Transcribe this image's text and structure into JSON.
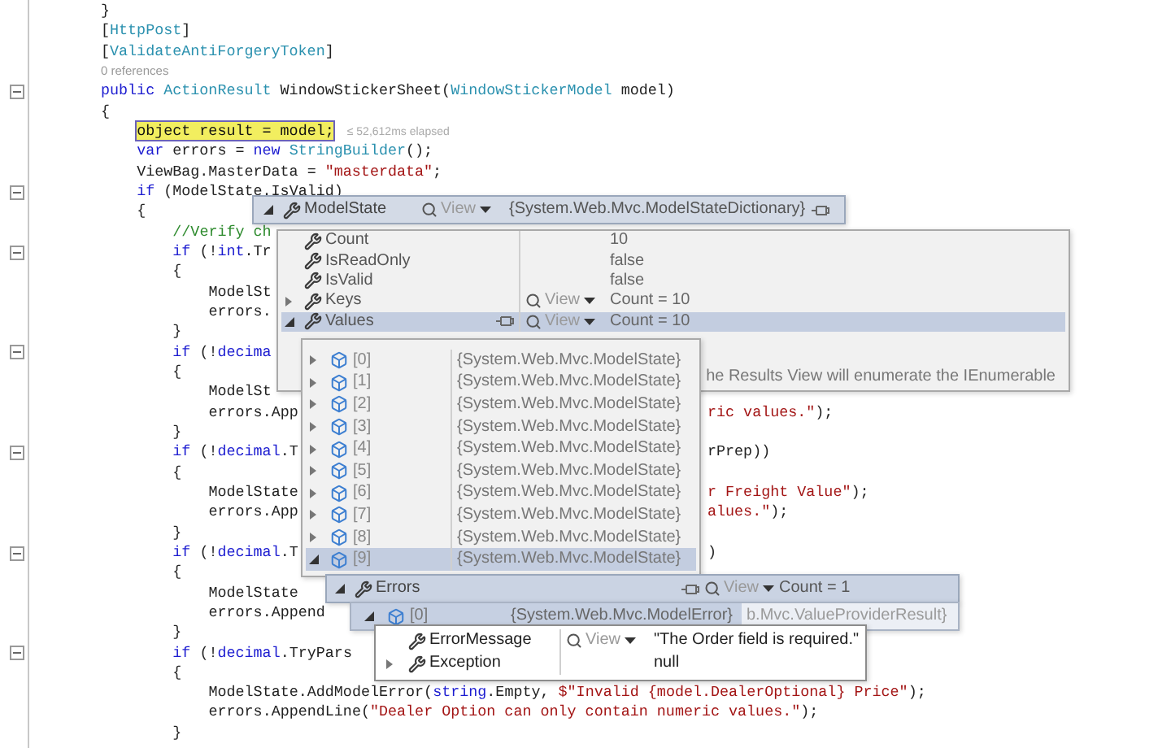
{
  "code": [
    {
      "kind": "code",
      "foldable": false,
      "segments": [
        {
          "kind": "plain",
          "text": "}"
        }
      ]
    },
    {
      "kind": "code",
      "foldable": false,
      "segments": [
        {
          "kind": "plain",
          "text": "["
        },
        {
          "kind": "type",
          "text": "HttpPost"
        },
        {
          "kind": "plain",
          "text": "]"
        }
      ]
    },
    {
      "kind": "code",
      "foldable": false,
      "segments": [
        {
          "kind": "plain",
          "text": "["
        },
        {
          "kind": "type",
          "text": "ValidateAntiForgeryToken"
        },
        {
          "kind": "plain",
          "text": "]"
        }
      ]
    },
    {
      "kind": "codelens",
      "foldable": false,
      "text": "0 references"
    },
    {
      "kind": "code",
      "foldable": true,
      "segments": [
        {
          "kind": "kw",
          "text": "public "
        },
        {
          "kind": "type",
          "text": "ActionResult "
        },
        {
          "kind": "plain",
          "text": "WindowStickerSheet("
        },
        {
          "kind": "type",
          "text": "WindowStickerModel "
        },
        {
          "kind": "plain",
          "text": "model)"
        }
      ]
    },
    {
      "kind": "code",
      "foldable": false,
      "segments": [
        {
          "kind": "plain",
          "text": "{"
        }
      ],
      "children": [
        {
          "kind": "code",
          "foldable": false,
          "segments": [
            {
              "kind": "current",
              "text": "object result = model;"
            }
          ],
          "note": "≤ 52,612ms elapsed"
        },
        {
          "kind": "code",
          "foldable": false,
          "segments": [
            {
              "kind": "kw",
              "text": "var "
            },
            {
              "kind": "plain",
              "text": "errors = "
            },
            {
              "kind": "kw",
              "text": "new "
            },
            {
              "kind": "type",
              "text": "StringBuilder"
            },
            {
              "kind": "plain",
              "text": "();"
            }
          ]
        },
        {
          "kind": "code",
          "foldable": false,
          "segments": [
            {
              "kind": "plain",
              "text": "ViewBag.MasterData = "
            },
            {
              "kind": "str",
              "text": "\"masterdata\""
            },
            {
              "kind": "plain",
              "text": ";"
            }
          ]
        },
        {
          "kind": "code",
          "foldable": true,
          "segments": [
            {
              "kind": "kw",
              "text": "if "
            },
            {
              "kind": "plain",
              "text": "(ModelState.IsValid)"
            }
          ]
        },
        {
          "kind": "code",
          "foldable": false,
          "segments": [
            {
              "kind": "plain",
              "text": "{"
            }
          ],
          "children": [
            {
              "kind": "code",
              "foldable": false,
              "segments": [
                {
                  "kind": "comment",
                  "text": "//Verify ch"
                }
              ]
            },
            {
              "kind": "code",
              "foldable": true,
              "segments": [
                {
                  "kind": "kw",
                  "text": "if "
                },
                {
                  "kind": "plain",
                  "text": "(!"
                },
                {
                  "kind": "kw",
                  "text": "int"
                },
                {
                  "kind": "plain",
                  "text": ".Tr"
                }
              ]
            },
            {
              "kind": "code",
              "foldable": false,
              "segments": [
                {
                  "kind": "plain",
                  "text": "{"
                }
              ],
              "children": [
                {
                  "kind": "code",
                  "foldable": false,
                  "segments": [
                    {
                      "kind": "plain",
                      "text": "ModelSt"
                    }
                  ]
                },
                {
                  "kind": "code",
                  "foldable": false,
                  "segments": [
                    {
                      "kind": "plain",
                      "text": "errors."
                    }
                  ]
                }
              ]
            },
            {
              "kind": "code",
              "foldable": false,
              "segments": [
                {
                  "kind": "plain",
                  "text": "}"
                }
              ]
            },
            {
              "kind": "code",
              "foldable": true,
              "segments": [
                {
                  "kind": "kw",
                  "text": "if "
                },
                {
                  "kind": "plain",
                  "text": "(!"
                },
                {
                  "kind": "kw",
                  "text": "decima"
                }
              ]
            },
            {
              "kind": "code",
              "foldable": false,
              "segments": [
                {
                  "kind": "plain",
                  "text": "{"
                }
              ],
              "children": [
                {
                  "kind": "code",
                  "foldable": false,
                  "segments": [
                    {
                      "kind": "plain",
                      "text": "ModelSt"
                    }
                  ]
                },
                {
                  "kind": "code",
                  "foldable": false,
                  "segments": [
                    {
                      "kind": "plain",
                      "text": "errors.App"
                    }
                  ],
                  "fragment": [
                    {
                      "kind": "str",
                      "text": "ric values.\""
                    },
                    {
                      "kind": "plain",
                      "text": ");"
                    }
                  ]
                }
              ]
            },
            {
              "kind": "code",
              "foldable": false,
              "segments": [
                {
                  "kind": "plain",
                  "text": "}"
                }
              ]
            },
            {
              "kind": "code",
              "foldable": true,
              "segments": [
                {
                  "kind": "kw",
                  "text": "if "
                },
                {
                  "kind": "plain",
                  "text": "(!"
                },
                {
                  "kind": "kw",
                  "text": "decimal"
                },
                {
                  "kind": "plain",
                  "text": ".T"
                }
              ],
              "fragment": [
                {
                  "kind": "plain",
                  "text": "rPrep))"
                }
              ]
            },
            {
              "kind": "code",
              "foldable": false,
              "segments": [
                {
                  "kind": "plain",
                  "text": "{"
                }
              ],
              "children": [
                {
                  "kind": "code",
                  "foldable": false,
                  "segments": [
                    {
                      "kind": "plain",
                      "text": "ModelState"
                    }
                  ],
                  "fragment": [
                    {
                      "kind": "str",
                      "text": "r Freight Value\""
                    },
                    {
                      "kind": "plain",
                      "text": ");"
                    }
                  ]
                },
                {
                  "kind": "code",
                  "foldable": false,
                  "segments": [
                    {
                      "kind": "plain",
                      "text": "errors.App"
                    }
                  ],
                  "fragment": [
                    {
                      "kind": "str",
                      "text": "alues.\""
                    },
                    {
                      "kind": "plain",
                      "text": ");"
                    }
                  ]
                }
              ]
            },
            {
              "kind": "code",
              "foldable": false,
              "segments": [
                {
                  "kind": "plain",
                  "text": "}"
                }
              ]
            },
            {
              "kind": "code",
              "foldable": true,
              "segments": [
                {
                  "kind": "kw",
                  "text": "if "
                },
                {
                  "kind": "plain",
                  "text": "(!"
                },
                {
                  "kind": "kw",
                  "text": "decimal"
                },
                {
                  "kind": "plain",
                  "text": ".T"
                }
              ],
              "fragment": [
                {
                  "kind": "plain",
                  "text": ")"
                }
              ]
            },
            {
              "kind": "code",
              "foldable": false,
              "segments": [
                {
                  "kind": "plain",
                  "text": "{"
                }
              ],
              "children": [
                {
                  "kind": "code",
                  "foldable": false,
                  "segments": [
                    {
                      "kind": "plain",
                      "text": "ModelState"
                    }
                  ]
                },
                {
                  "kind": "code",
                  "foldable": false,
                  "segments": [
                    {
                      "kind": "plain",
                      "text": "errors.Append"
                    }
                  ]
                }
              ]
            },
            {
              "kind": "code",
              "foldable": false,
              "segments": [
                {
                  "kind": "plain",
                  "text": "}"
                }
              ]
            },
            {
              "kind": "code",
              "foldable": true,
              "segments": [
                {
                  "kind": "kw",
                  "text": "if "
                },
                {
                  "kind": "plain",
                  "text": "(!"
                },
                {
                  "kind": "kw",
                  "text": "decimal"
                },
                {
                  "kind": "plain",
                  "text": ".TryPars"
                }
              ]
            },
            {
              "kind": "code",
              "foldable": false,
              "segments": [
                {
                  "kind": "plain",
                  "text": "{"
                }
              ],
              "children": [
                {
                  "kind": "code",
                  "foldable": false,
                  "segments": [
                    {
                      "kind": "plain",
                      "text": "ModelState.AddModelError("
                    },
                    {
                      "kind": "kw",
                      "text": "string"
                    },
                    {
                      "kind": "plain",
                      "text": ".Empty, "
                    },
                    {
                      "kind": "str",
                      "text": "$\"Invalid {model.DealerOptional} Price\""
                    },
                    {
                      "kind": "plain",
                      "text": ");"
                    }
                  ]
                },
                {
                  "kind": "code",
                  "foldable": false,
                  "segments": [
                    {
                      "kind": "plain",
                      "text": "errors.AppendLine("
                    },
                    {
                      "kind": "str",
                      "text": "\"Dealer Option can only contain numeric values.\""
                    },
                    {
                      "kind": "plain",
                      "text": ");"
                    }
                  ]
                }
              ]
            },
            {
              "kind": "code",
              "foldable": false,
              "segments": [
                {
                  "kind": "plain",
                  "text": "}"
                }
              ]
            }
          ]
        }
      ]
    }
  ],
  "datatip": {
    "root": {
      "name": "ModelState",
      "expandable": true,
      "expanded": true,
      "view": "View",
      "value": "{System.Web.Mvc.ModelStateDictionary}"
    },
    "members": [
      {
        "name": "Count",
        "expandable": false,
        "selected": false,
        "value": "10"
      },
      {
        "name": "IsReadOnly",
        "expandable": false,
        "selected": false,
        "value": "false"
      },
      {
        "name": "IsValid",
        "expandable": false,
        "selected": false,
        "value": "false"
      },
      {
        "name": "Keys",
        "expandable": true,
        "expanded": false,
        "selected": false,
        "view": "View",
        "value": "Count = 10"
      },
      {
        "name": "Values",
        "expandable": true,
        "expanded": true,
        "selected": true,
        "view": "View",
        "value": "Count = 10"
      }
    ],
    "members_note": "he Results View will enumerate the IEnumerable",
    "values": [
      {
        "name": "[0]",
        "expandable": true,
        "expanded": false,
        "selected": false,
        "value": "{System.Web.Mvc.ModelState}"
      },
      {
        "name": "[1]",
        "expandable": true,
        "expanded": false,
        "selected": false,
        "value": "{System.Web.Mvc.ModelState}"
      },
      {
        "name": "[2]",
        "expandable": true,
        "expanded": false,
        "selected": false,
        "value": "{System.Web.Mvc.ModelState}"
      },
      {
        "name": "[3]",
        "expandable": true,
        "expanded": false,
        "selected": false,
        "value": "{System.Web.Mvc.ModelState}"
      },
      {
        "name": "[4]",
        "expandable": true,
        "expanded": false,
        "selected": false,
        "value": "{System.Web.Mvc.ModelState}"
      },
      {
        "name": "[5]",
        "expandable": true,
        "expanded": false,
        "selected": false,
        "value": "{System.Web.Mvc.ModelState}"
      },
      {
        "name": "[6]",
        "expandable": true,
        "expanded": false,
        "selected": false,
        "value": "{System.Web.Mvc.ModelState}"
      },
      {
        "name": "[7]",
        "expandable": true,
        "expanded": false,
        "selected": false,
        "value": "{System.Web.Mvc.ModelState}"
      },
      {
        "name": "[8]",
        "expandable": true,
        "expanded": false,
        "selected": false,
        "value": "{System.Web.Mvc.ModelState}"
      },
      {
        "name": "[9]",
        "expandable": true,
        "expanded": true,
        "selected": true,
        "value": "{System.Web.Mvc.ModelState}"
      }
    ],
    "errors": {
      "name": "Errors",
      "expandable": true,
      "expanded": true,
      "view": "View",
      "value": "Count = 1"
    },
    "error_item": {
      "name": "[0]",
      "expandable": true,
      "expanded": true,
      "value": "{System.Web.Mvc.ModelError}",
      "behind": "b.Mvc.ValueProviderResult}"
    },
    "error_detail": [
      {
        "name": "ErrorMessage",
        "expandable": false,
        "view": "View",
        "value": "\"The Order field is required.\""
      },
      {
        "name": "Exception",
        "expandable": true,
        "expanded": false,
        "value": "null"
      }
    ]
  }
}
